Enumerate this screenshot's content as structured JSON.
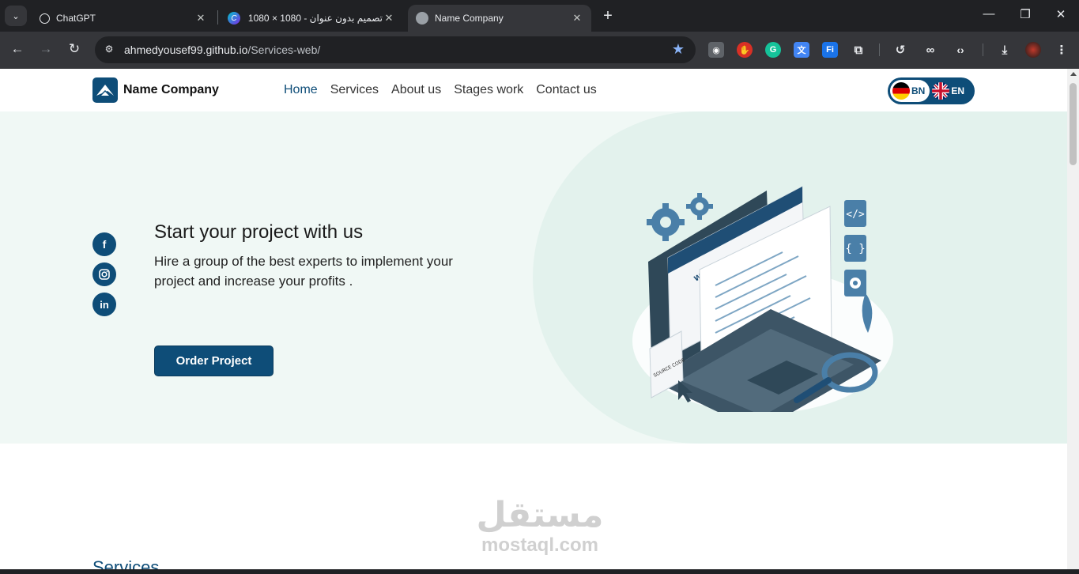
{
  "browser": {
    "tabs": [
      {
        "title": "ChatGPT",
        "active": false
      },
      {
        "title": "تصميم بدون عنوان - 1080 × 1080",
        "active": false
      },
      {
        "title": "Name Company",
        "active": true
      }
    ],
    "url_host": "ahmedyousef99.github.io",
    "url_path": "/Services-web/",
    "extensions": [
      "camera-icon",
      "adblock-icon",
      "grammarly-icon",
      "translate-icon",
      "fi-icon",
      "puzzle-icon",
      "history-icon",
      "link-icon",
      "code-icon",
      "download-icon",
      "profile-avatar"
    ]
  },
  "site": {
    "logo_text": "Name Company",
    "nav": [
      "Home",
      "Services",
      "About us",
      "Stages work",
      "Contact us"
    ],
    "active_nav": "Home",
    "lang": {
      "option1": "BN",
      "option2": "EN",
      "selected": "BN"
    }
  },
  "hero": {
    "title": "Start your project with us",
    "subtitle": "Hire a group of the best experts to implement your project and increase your profits .",
    "button": "Order Project",
    "social": [
      "facebook-icon",
      "instagram-icon",
      "linkedin-icon"
    ],
    "illustration_labels": {
      "website": "WEBSITE",
      "source": "SOURCE CODE"
    }
  },
  "watermark": {
    "ar": "مستقل",
    "en": "mostaql.com"
  },
  "services": {
    "title": "Services"
  },
  "colors": {
    "brand": "#0e4d78",
    "hero_bg": "#f0f8f5",
    "blob": "#e3f2ed"
  }
}
